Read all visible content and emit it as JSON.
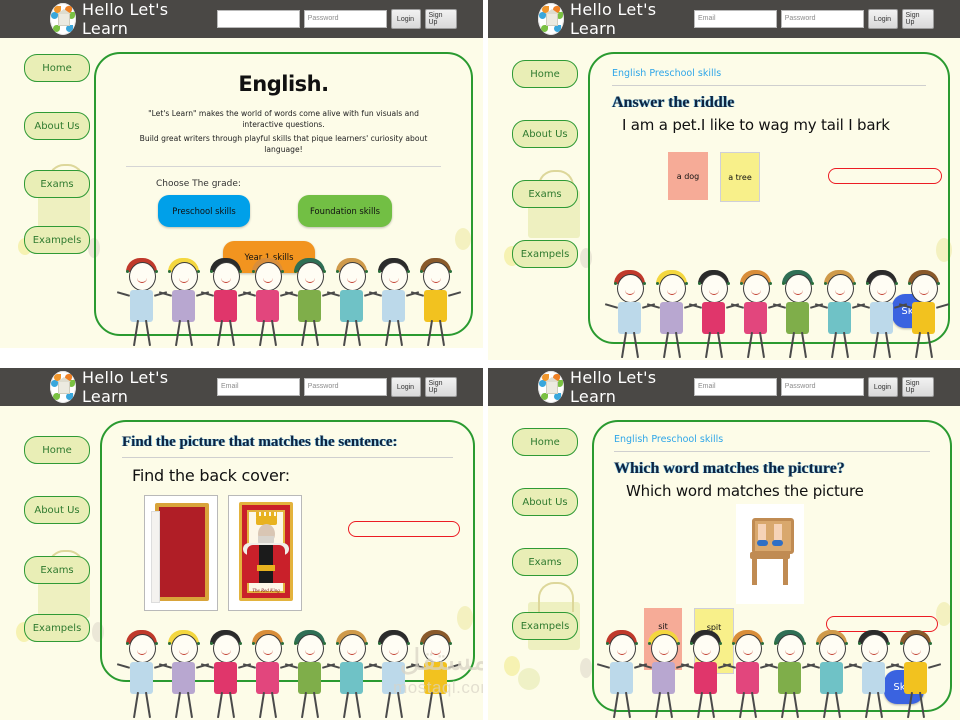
{
  "header": {
    "brand": "Hello Let's Learn",
    "logo_icon": "learning-logo-icon",
    "email_placeholder": "Email",
    "password_placeholder": "Password",
    "email_value": "",
    "password_value": "",
    "login_label": "Login",
    "signup_label": "Sign Up"
  },
  "sidebar": {
    "items": [
      {
        "label": "Home",
        "name": "home"
      },
      {
        "label": "About Us",
        "name": "about-us"
      },
      {
        "label": "Exams",
        "name": "exams"
      },
      {
        "label": "Exampels",
        "name": "exampels"
      }
    ]
  },
  "panels": {
    "p1": {
      "title": "English.",
      "intro_line1": "\"Let's Learn\" makes the world of words come alive with fun visuals and interactive questions.",
      "intro_line2": "Build great writers through playful skills that pique learners' curiosity about language!",
      "choose_label": "Choose  The grade:",
      "grades": [
        {
          "label": "Preschool skills",
          "color": "#00a0e9"
        },
        {
          "label": "Foundation skills",
          "color": "#72bf44"
        },
        {
          "label": "Year 1 skills",
          "color": "#f2941f"
        }
      ]
    },
    "p2": {
      "breadcrumb": "English Preschool skills",
      "title": "Answer the riddle",
      "question": "I am a pet.I like to wag my tail I bark",
      "options": [
        {
          "label": "a dog",
          "color": "#f6ab97"
        },
        {
          "label": "a tree",
          "color": "#f8f08a"
        }
      ],
      "answer_value": "",
      "skip_label": "Skip"
    },
    "p3": {
      "title": "Find the picture that matches the sentence:",
      "question": "Find the back cover:",
      "images": [
        {
          "name": "book-back-cover-image",
          "caption": ""
        },
        {
          "name": "book-front-cover-image",
          "caption": "The Red King"
        }
      ],
      "answer_value": ""
    },
    "p4": {
      "breadcrumb": "English Preschool skills",
      "title": "Which word matches the picture?",
      "question": "Which word matches the picture",
      "picture_name": "boy-sitting-on-chair-image",
      "options": [
        {
          "label": "sit",
          "color": "#f6ab97"
        },
        {
          "label": "spit",
          "color": "#f8f08a"
        }
      ],
      "answer_value": "",
      "skip_label": "Skip"
    }
  },
  "watermark": {
    "arabic": "مستقل",
    "latin": "mostaql.com"
  },
  "theme": {
    "topbar": "#4a4845",
    "page_bg": "#fdfce8",
    "card_border": "#2a9a30",
    "nav_bg": "#e9eeb6",
    "nav_text": "#2f7a2f",
    "crumb": "#2fa6e8",
    "answer_outline": "#ec1c24",
    "skip": "#3a63e0"
  }
}
